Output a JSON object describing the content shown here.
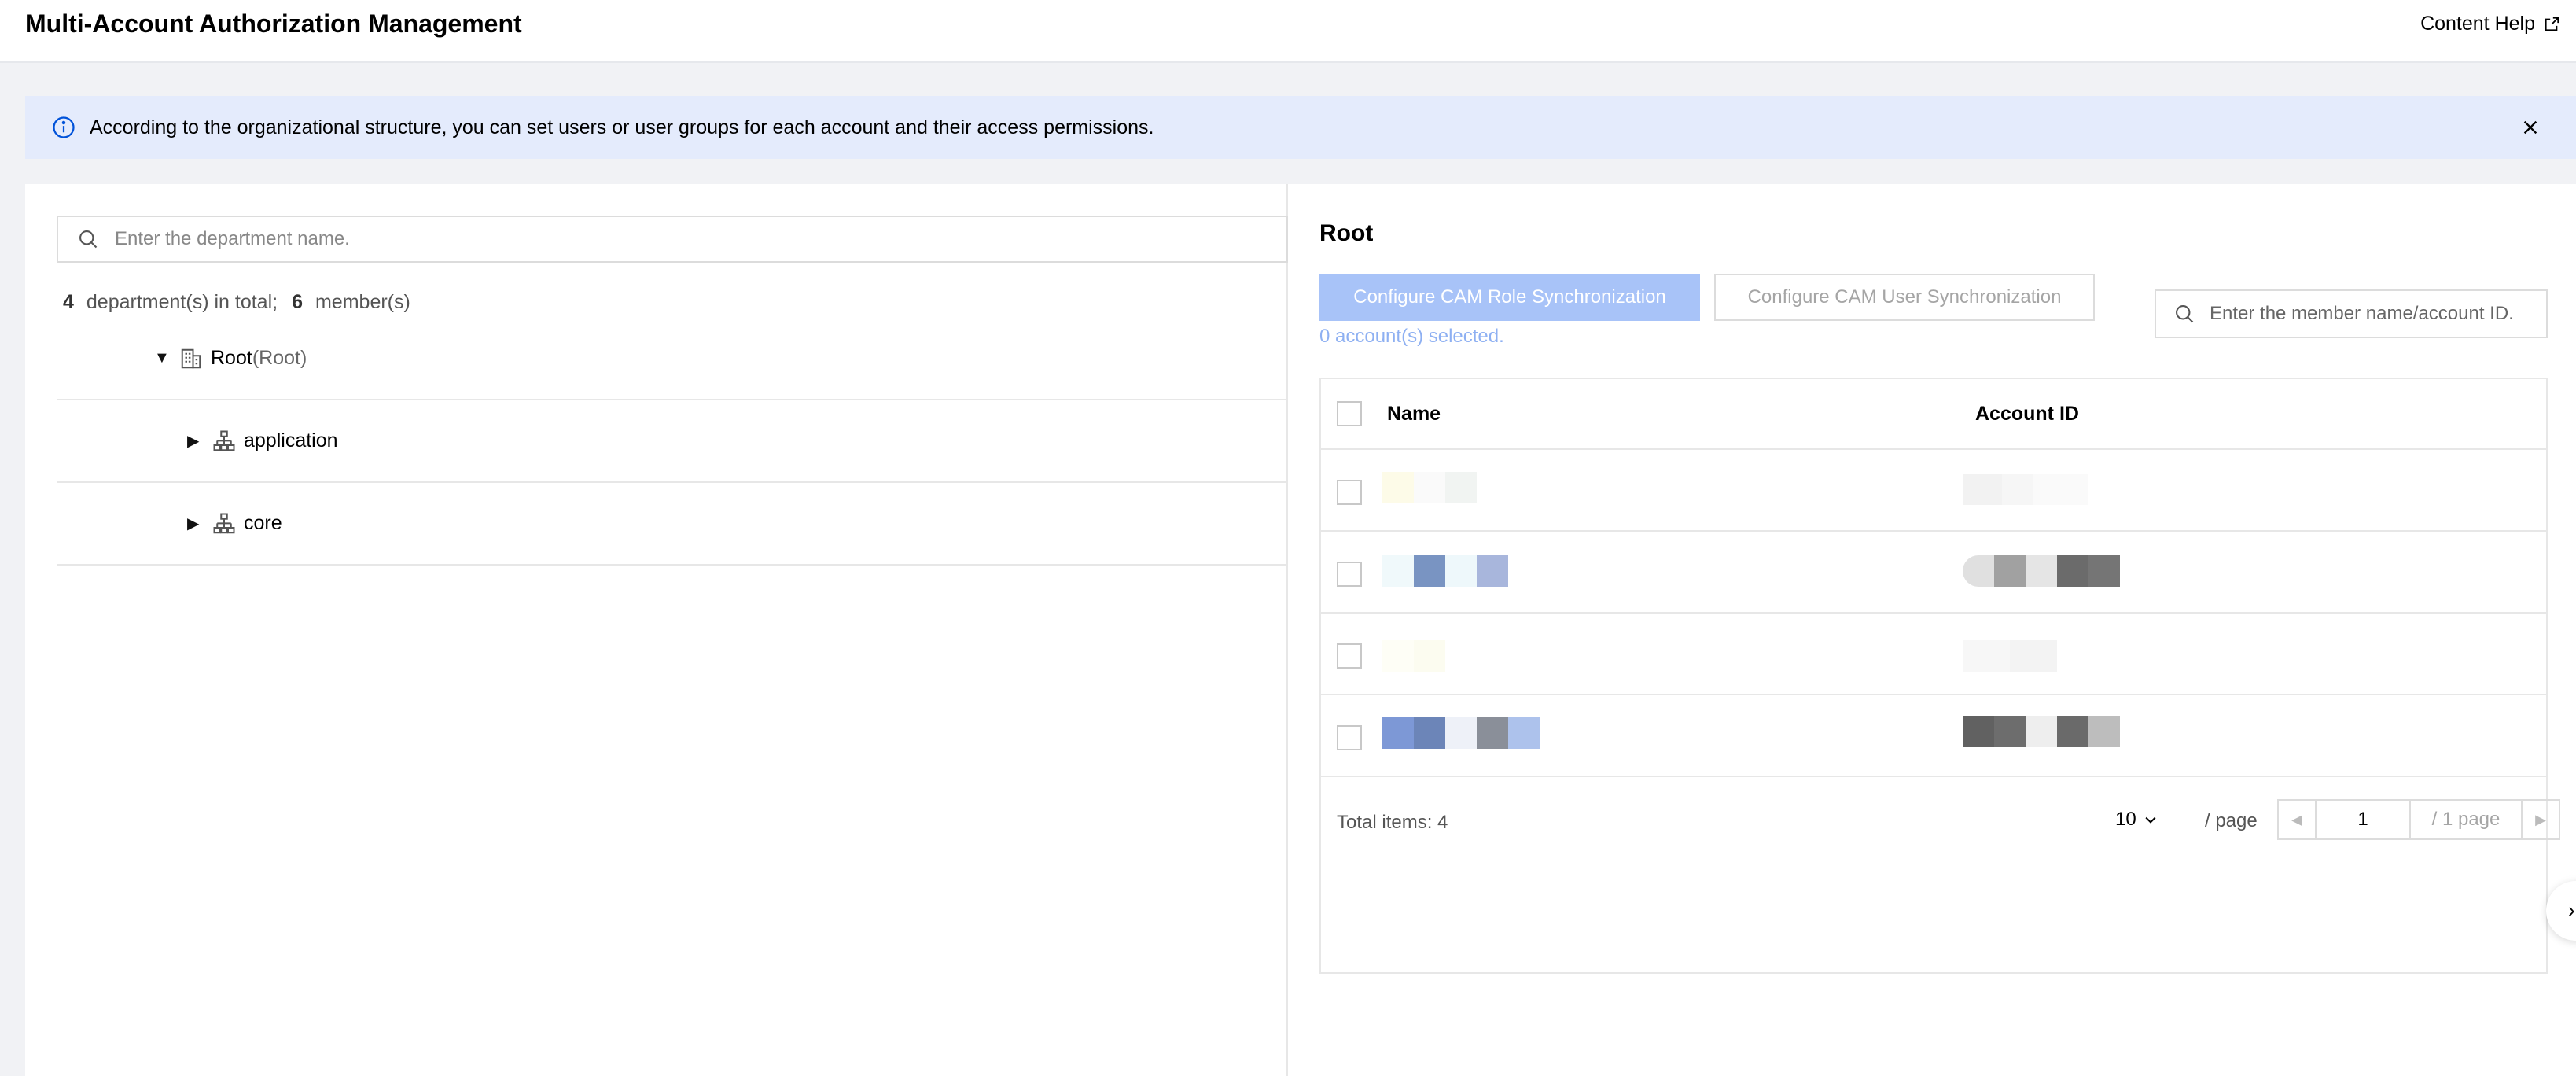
{
  "header": {
    "title": "Multi-Account Authorization Management",
    "help_label": "Content Help"
  },
  "banner": {
    "message": "According to the organizational structure, you can set users or user groups for each account and their access permissions."
  },
  "left": {
    "search_placeholder": "Enter the department name.",
    "summary": {
      "dept_count": "4",
      "dept_label": "department(s) in total;",
      "member_count": "6",
      "member_label": "member(s)"
    },
    "tree": [
      {
        "label": "Root",
        "sub": "(Root)"
      },
      {
        "label": "application"
      },
      {
        "label": "core"
      }
    ]
  },
  "right": {
    "title": "Root",
    "role_sync_label": "Configure CAM Role Synchronization",
    "user_sync_label": "Configure CAM User Synchronization",
    "selected_note": "0 account(s) selected.",
    "member_search_placeholder": "Enter the member name/account ID.",
    "table": {
      "columns": [
        "Name",
        "Account ID"
      ]
    },
    "footer": {
      "total": "Total items: 4",
      "page_size": "10",
      "per_page": "/ page",
      "current_page": "1",
      "of_pages": "/ 1 page"
    }
  },
  "colors": {
    "primary_disabled": "#a8c3f8",
    "banner_bg": "#e4ebfc",
    "link_blue": "#0052d9"
  },
  "icons": [
    "external-link-icon",
    "info-icon",
    "close-icon",
    "search-icon",
    "building-icon",
    "org-chart-icon",
    "caret-down-icon",
    "caret-right-icon"
  ]
}
